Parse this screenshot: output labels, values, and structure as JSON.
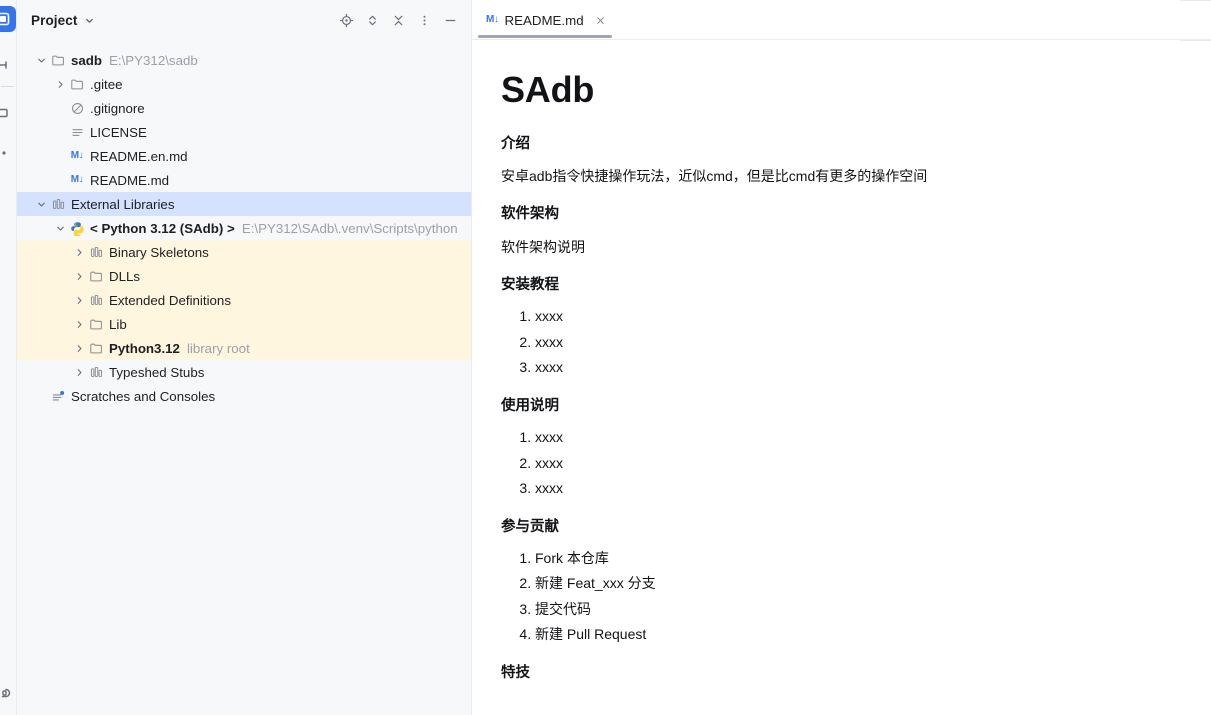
{
  "activity_bar": {
    "items": [
      {
        "name": "project-tool-icon",
        "active": true
      },
      {
        "name": "bookmarks-icon",
        "active": false
      },
      {
        "name": "structure-icon",
        "active": false
      },
      {
        "name": "notifications-icon",
        "active": false
      },
      {
        "name": "terminal-icon",
        "active": false
      }
    ]
  },
  "panel": {
    "title": "Project",
    "toolbar": [
      {
        "label": "Select Opened File",
        "icon": "locate-icon"
      },
      {
        "label": "Expand All",
        "icon": "expand-collapse-icon"
      },
      {
        "label": "Collapse All",
        "icon": "collapse-all-icon"
      },
      {
        "label": "Options",
        "icon": "more-vertical-icon"
      },
      {
        "label": "Hide",
        "icon": "minimize-icon"
      }
    ],
    "tree": [
      {
        "indent": 0,
        "arrow": "down",
        "icon": "folder-icon",
        "label": "sadb",
        "bold": true,
        "hint": "E:\\PY312\\sadb",
        "state": "normal"
      },
      {
        "indent": 1,
        "arrow": "right",
        "icon": "folder-icon",
        "label": ".gitee",
        "bold": false,
        "hint": "",
        "state": "normal"
      },
      {
        "indent": 1,
        "arrow": "none",
        "icon": "gitignore-icon",
        "label": ".gitignore",
        "bold": false,
        "hint": "",
        "state": "normal"
      },
      {
        "indent": 1,
        "arrow": "none",
        "icon": "text-file-icon",
        "label": "LICENSE",
        "bold": false,
        "hint": "",
        "state": "normal"
      },
      {
        "indent": 1,
        "arrow": "none",
        "icon": "markdown-icon",
        "label": "README.en.md",
        "bold": false,
        "hint": "",
        "state": "normal"
      },
      {
        "indent": 1,
        "arrow": "none",
        "icon": "markdown-icon",
        "label": "README.md",
        "bold": false,
        "hint": "",
        "state": "normal"
      },
      {
        "indent": 0,
        "arrow": "down",
        "icon": "library-icon",
        "label": "External Libraries",
        "bold": false,
        "hint": "",
        "state": "selected"
      },
      {
        "indent": 1,
        "arrow": "down",
        "icon": "python-icon",
        "label": "< Python 3.12 (SAdb) >",
        "bold": true,
        "hint": "E:\\PY312\\SAdb\\.venv\\Scripts\\python",
        "state": "normal"
      },
      {
        "indent": 2,
        "arrow": "right",
        "icon": "library-icon",
        "label": "Binary Skeletons",
        "bold": false,
        "hint": "",
        "state": "lib"
      },
      {
        "indent": 2,
        "arrow": "right",
        "icon": "folder-icon",
        "label": "DLLs",
        "bold": false,
        "hint": "",
        "state": "lib"
      },
      {
        "indent": 2,
        "arrow": "right",
        "icon": "library-icon",
        "label": "Extended Definitions",
        "bold": false,
        "hint": "",
        "state": "lib"
      },
      {
        "indent": 2,
        "arrow": "right",
        "icon": "folder-icon",
        "label": "Lib",
        "bold": false,
        "hint": "",
        "state": "lib"
      },
      {
        "indent": 2,
        "arrow": "right",
        "icon": "folder-icon",
        "label": "Python3.12",
        "bold": true,
        "hint": "library root",
        "state": "lib"
      },
      {
        "indent": 2,
        "arrow": "right",
        "icon": "library-icon",
        "label": "Typeshed Stubs",
        "bold": false,
        "hint": "",
        "state": "normal"
      },
      {
        "indent": 0,
        "arrow": "none",
        "icon": "scratches-icon",
        "label": "Scratches and Consoles",
        "bold": false,
        "hint": "",
        "state": "normal"
      }
    ]
  },
  "editor": {
    "tabs": [
      {
        "label": "README.md",
        "icon": "markdown-icon",
        "badge": "M↓",
        "active": true,
        "close": "×"
      }
    ]
  },
  "preview": {
    "title": "SAdb",
    "blocks": [
      {
        "type": "h2",
        "text": "介绍"
      },
      {
        "type": "p",
        "text": "安卓adb指令快捷操作玩法，近似cmd，但是比cmd有更多的操作空间"
      },
      {
        "type": "h2",
        "text": "软件架构"
      },
      {
        "type": "p",
        "text": "软件架构说明"
      },
      {
        "type": "h2",
        "text": "安装教程"
      },
      {
        "type": "ol",
        "items": [
          "xxxx",
          "xxxx",
          "xxxx"
        ]
      },
      {
        "type": "h2",
        "text": "使用说明"
      },
      {
        "type": "ol",
        "items": [
          "xxxx",
          "xxxx",
          "xxxx"
        ]
      },
      {
        "type": "h2",
        "text": "参与贡献"
      },
      {
        "type": "ol",
        "items": [
          "Fork 本仓库",
          "新建 Feat_xxx 分支",
          "提交代码",
          "新建 Pull Request"
        ]
      },
      {
        "type": "h2",
        "text": "特技"
      }
    ]
  },
  "colors": {
    "panel_bg": "#f7f8fa",
    "selection_bg": "#d4e2ff",
    "library_bg": "#fff6e0",
    "accent_blue": "#3574f0",
    "text": "#1e1f22",
    "muted": "#9ca0a8",
    "tab_underline": "#a0a5b4"
  }
}
